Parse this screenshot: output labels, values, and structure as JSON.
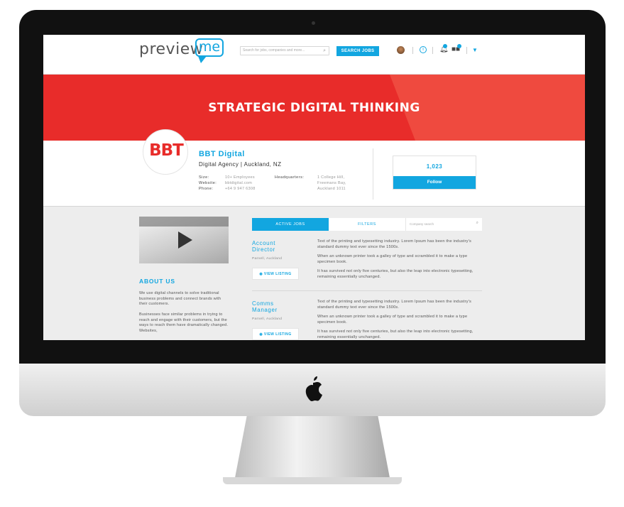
{
  "header": {
    "logo_preview": "preview",
    "logo_me": "me",
    "search_placeholder": "Search for jobs, companies and more...",
    "search_button": "SEARCH JOBS"
  },
  "banner": {
    "title": "STRATEGIC DIGITAL THINKING"
  },
  "company": {
    "logo_text": "BBT",
    "name": "BBT Digital",
    "type": "Digital Agency | Auckland, NZ",
    "size_label": "Size:",
    "size_value": "10+ Employees",
    "website_label": "Website:",
    "website_value": "bbtdigital.com",
    "phone_label": "Phone:",
    "phone_value": "+64 9 947 6308",
    "hq_label": "Headquarters:",
    "hq_line1": "1 College Hill,",
    "hq_line2": "Freemans Bay,",
    "hq_line3": "Auckland 1011",
    "followers": "1,023",
    "follow_button": "Follow"
  },
  "about": {
    "heading": "ABOUT US",
    "para1": "We use digital channels to solve traditional business problems and connect brands with their customers.",
    "para2": "Businesses face similar problems in trying to reach and engage with their customers, but the ways to reach them have dramatically changed. Websites,"
  },
  "tabs": {
    "active_jobs": "ACTIVE JOBS",
    "filters": "FILTERS",
    "search_placeholder": "Company search"
  },
  "jobs": [
    {
      "title_line1": "Account",
      "title_line2": "Director",
      "location": "Parnell, Auckland",
      "view_label": "VIEW LISTING",
      "desc1": "Text of the printing and typesetting industry. Lorem Ipsum has been the industry's standard dummy text ever since the 1500s.",
      "desc2": "When an unknown printer took a galley of type and scrambled it to make a type specimen book.",
      "desc3": "It has survived not only five centuries, but also the leap into electronic typesetting, remaining essentially unchanged."
    },
    {
      "title_line1": "Comms",
      "title_line2": "Manager",
      "location": "Parnell, Auckland",
      "view_label": "VIEW LISTING",
      "desc1": "Text of the printing and typesetting industry. Lorem Ipsum has been the industry's standard dummy text ever since the 1500s.",
      "desc2": "When an unknown printer took a galley of type and scrambled it to make a type specimen book.",
      "desc3": "It has survived not only five centuries, but also the leap into electronic typesetting, remaining essentially unchanged."
    }
  ],
  "icons": {
    "search": "search-icon",
    "info": "info-icon",
    "bell": "bell-icon",
    "jobs": "briefcase-icon",
    "chevron": "chevron-down-icon",
    "play": "play-icon",
    "eye": "eye-icon",
    "apple": "apple-logo-icon"
  },
  "colors": {
    "accent": "#12a6e0",
    "banner": "#e82c2a"
  }
}
